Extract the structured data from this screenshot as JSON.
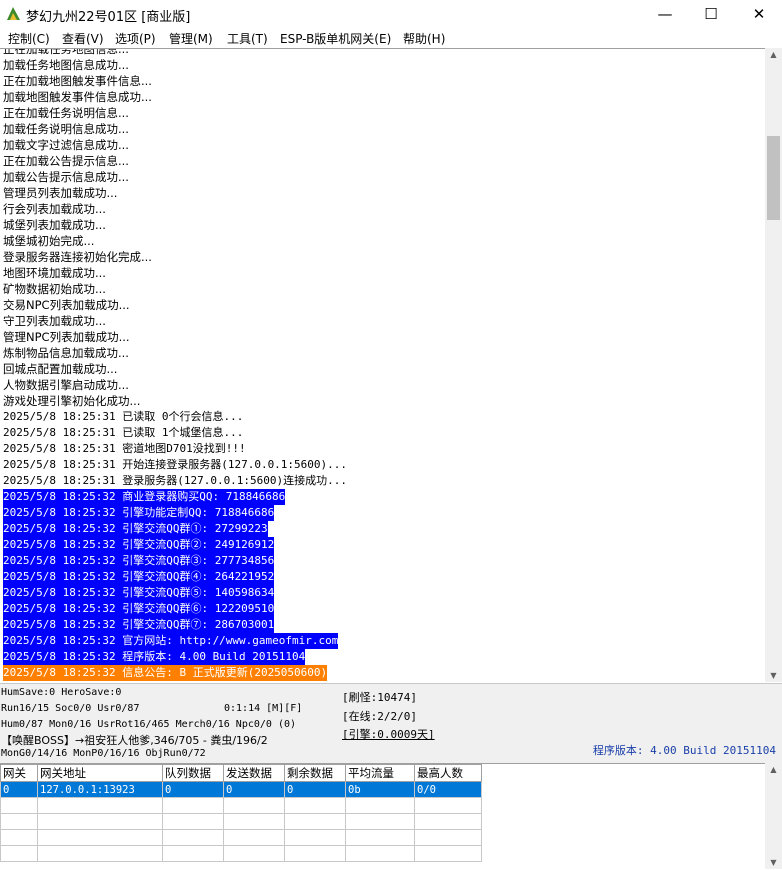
{
  "window": {
    "title": "梦幻九州22号01区 [商业版]",
    "minimize": "—",
    "maximize": "☐",
    "close": "✕"
  },
  "menu": [
    "控制(C)",
    "查看(V)",
    "选项(P)",
    "管理(M)",
    "工具(T)",
    "ESP-B版单机网关(E)",
    "帮助(H)"
  ],
  "log": [
    "正在加载任务地图信息...",
    "加载任务地图信息成功...",
    "正在加载地图触发事件信息...",
    "加载地图触发事件信息成功...",
    "正在加载任务说明信息...",
    "加载任务说明信息成功...",
    "加载文字过滤信息成功...",
    "正在加载公告提示信息...",
    "加载公告提示信息成功...",
    "管理员列表加载成功...",
    "行会列表加载成功...",
    "城堡列表加载成功...",
    "城堡城初始完成...",
    "登录服务器连接初始化完成...",
    "地图环境加载成功...",
    "矿物数据初始成功...",
    "交易NPC列表加载成功...",
    "守卫列表加载成功...",
    "管理NPC列表加载成功...",
    "炼制物品信息加载成功...",
    "回城点配置加载成功...",
    "人物数据引擎启动成功...",
    "游戏处理引擎初始化成功...",
    "2025/5/8 18:25:31 已读取 0个行会信息...",
    "2025/5/8 18:25:31 已读取 1个城堡信息...",
    "2025/5/8 18:25:31 密道地图D701没找到!!!",
    "2025/5/8 18:25:31 开始连接登录服务器(127.0.0.1:5600)...",
    "2025/5/8 18:25:31 登录服务器(127.0.0.1:5600)连接成功...",
    "2025/5/8 18:25:32 商业登录器购买QQ: 718846686",
    "2025/5/8 18:25:32 引擎功能定制QQ: 718846686",
    "2025/5/8 18:25:32 引擎交流QQ群①: 27299223",
    "2025/5/8 18:25:32 引擎交流QQ群②: 249126912",
    "2025/5/8 18:25:32 引擎交流QQ群③: 277734856",
    "2025/5/8 18:25:32 引擎交流QQ群④: 264221952",
    "2025/5/8 18:25:32 引擎交流QQ群⑤: 140598634",
    "2025/5/8 18:25:32 引擎交流QQ群⑥: 122209510",
    "2025/5/8 18:25:32 引擎交流QQ群⑦: 286703001",
    "2025/5/8 18:25:32 官方网站: http://www.gameofmir.com",
    "2025/5/8 18:25:32 程序版本: 4.00 Build 20151104",
    "2025/5/8 18:25:32 信息公告: B 正式版更新(2025050600)"
  ],
  "highlight": {
    "blue_start": 28,
    "blue_end": 38,
    "orange": 39,
    "blue_color": "#0000ff",
    "orange_color": "#ff8000"
  },
  "status": {
    "line1": "HumSave:0 HeroSave:0",
    "line2a": "Run16/15 Soc0/0 Usr0/87",
    "line2b": "0:1:14 [M][F]",
    "line3": "Hum0/87 Mon0/16 UsrRot16/465 Merch0/16 Npc0/0 (0)",
    "line4": "【唤醒BOSS】→祖安狂人他爹,346/705 - 粪虫/196/2",
    "line5": "MonG0/14/16 MonP0/16/16 ObjRun0/72",
    "refresh": "[刷怪:10474]",
    "online": "[在线:2/2/0]",
    "engine": "[引擎:0.0009天]",
    "version": "程序版本: 4.00 Build 20151104"
  },
  "grid": {
    "headers": [
      "网关",
      "网关地址",
      "队列数据",
      "发送数据",
      "剩余数据",
      "平均流量",
      "最高人数"
    ],
    "rows": [
      [
        "0",
        "127.0.0.1:13923",
        "0",
        "0",
        "0",
        "0b",
        "0/0"
      ]
    ]
  }
}
